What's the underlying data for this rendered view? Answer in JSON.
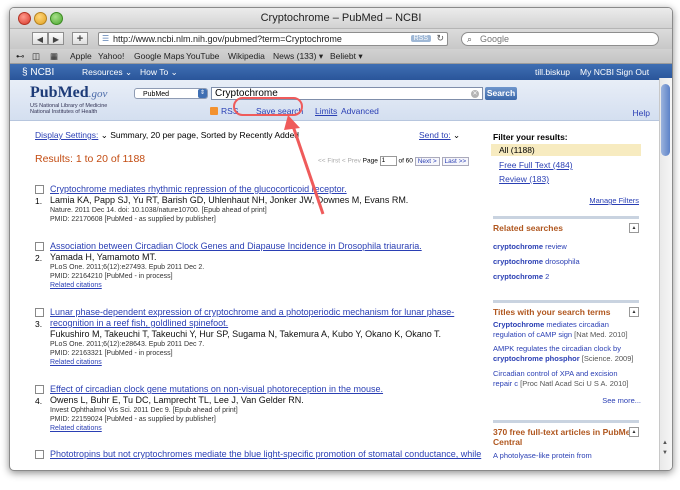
{
  "window": {
    "title": "Cryptochrome – PubMed – NCBI"
  },
  "browser": {
    "back": "◀",
    "forward": "▶",
    "add": "+",
    "url": "http://www.ncbi.nlm.nih.gov/pubmed?term=Cryptochrome",
    "rss_label": "RSS",
    "search_placeholder": "Google",
    "bookmarks": [
      "Apple",
      "Yahoo!",
      "Google Maps",
      "YouTube",
      "Wikipedia",
      "News (133) ▾",
      "Beliebt ▾"
    ]
  },
  "ncbi_bar": {
    "logo": "NCBI",
    "resources": "Resources",
    "howto": "How To",
    "user": "till.biskup",
    "my_ncbi": "My NCBI",
    "sign_out": "Sign Out"
  },
  "pubmed": {
    "logo_pub": "Pub",
    "logo_med": "Med",
    "logo_gov": ".gov",
    "logo_sub1": "US National Library of Medicine",
    "logo_sub2": "National Institutes of Health",
    "db": "PubMed",
    "term": "Cryptochrome",
    "search_button": "Search",
    "rss": "RSS",
    "save_search": "Save search",
    "limits": "Limits",
    "advanced": "Advanced",
    "help": "Help"
  },
  "display": {
    "settings_label": "Display Settings:",
    "settings_value": "Summary, 20 per page, Sorted by Recently Added",
    "send_to": "Send to:",
    "results": "Results: 1 to 20 of 1188",
    "pager": {
      "first": "<< First",
      "prev": "< Prev",
      "page_label": "Page",
      "page": "1",
      "of": "of 60",
      "next": "Next >",
      "last": "Last >>"
    }
  },
  "results": [
    {
      "number": "1.",
      "title": "Cryptochrome mediates rhythmic repression of the glucocorticoid receptor.",
      "authors": "Lamia KA, Papp SJ, Yu RT, Barish GD, Uhlenhaut NH, Jonker JW, Downes M, Evans RM.",
      "source": "Nature. 2011 Dec 14. doi: 10.1038/nature10700. [Epub ahead of print]",
      "pmid": "PMID: 22170608 [PubMed - as supplied by publisher]",
      "related": ""
    },
    {
      "number": "2.",
      "title": "Association between Circadian Clock Genes and Diapause Incidence in Drosophila triauraria.",
      "authors": "Yamada H, Yamamoto MT.",
      "source": "PLoS One. 2011;6(12):e27493. Epub 2011 Dec 2.",
      "pmid": "PMID: 22164210 [PubMed - in process]",
      "related": "Related citations"
    },
    {
      "number": "3.",
      "title": "Lunar phase-dependent expression of cryptochrome and a photoperiodic mechanism for lunar phase-recognition in a reef fish, goldlined spinefoot.",
      "authors": "Fukushiro M, Takeuchi T, Takeuchi Y, Hur SP, Sugama N, Takemura A, Kubo Y, Okano K, Okano T.",
      "source": "PLoS One. 2011;6(12):e28643. Epub 2011 Dec 7.",
      "pmid": "PMID: 22163321 [PubMed - in process]",
      "related": "Related citations"
    },
    {
      "number": "4.",
      "title": "Effect of circadian clock gene mutations on non-visual photoreception in the mouse.",
      "authors": "Owens L, Buhr E, Tu DC, Lamprecht TL, Lee J, Van Gelder RN.",
      "source": "Invest Ophthalmol Vis Sci. 2011 Dec 9. [Epub ahead of print]",
      "pmid": "PMID: 22159024 [PubMed - as supplied by publisher]",
      "related": "Related citations"
    },
    {
      "number": "",
      "title": "Phototropins but not cryptochromes mediate the blue light-specific promotion of stomatal conductance, while",
      "authors": "",
      "source": "",
      "pmid": "",
      "related": ""
    }
  ],
  "sidebar": {
    "filter_heading": "Filter your results:",
    "filters": [
      "All (1188)",
      "Free Full Text (484)",
      "Review (183)"
    ],
    "manage_filters": "Manage Filters",
    "related_heading": "Related searches",
    "related": [
      {
        "bold": "cryptochrome",
        "rest": " review"
      },
      {
        "bold": "cryptochrome",
        "rest": " drosophila"
      },
      {
        "bold": "cryptochrome",
        "rest": " 2"
      }
    ],
    "titles_heading": "Titles with your search terms",
    "titles": [
      {
        "l1b": "Cryptochrome",
        "l1": " mediates circadian",
        "l2": "regulation of cAMP sign",
        "l2dim": "[Nat Med. 2010]"
      },
      {
        "l1b": "",
        "l1": "AMPK regulates the circadian clock by",
        "l2": "cryptochrome phosphor",
        "l2dim": "[Science. 2009]"
      },
      {
        "l1b": "",
        "l1": "Circadian control of XPA and excision",
        "l2": "repair c",
        "l2dim": "[Proc Natl Acad Sci U S A. 2010]"
      }
    ],
    "see_more": "See more...",
    "free_heading": "370 free full-text articles in PubMed Central",
    "free_first": "A photolyase-like protein from"
  },
  "colors": {
    "accent": "#2a3fb4",
    "results_title": "#c34c12",
    "highlight": "#ef5b5b",
    "ncbi_bar": "#2f5ea4"
  }
}
